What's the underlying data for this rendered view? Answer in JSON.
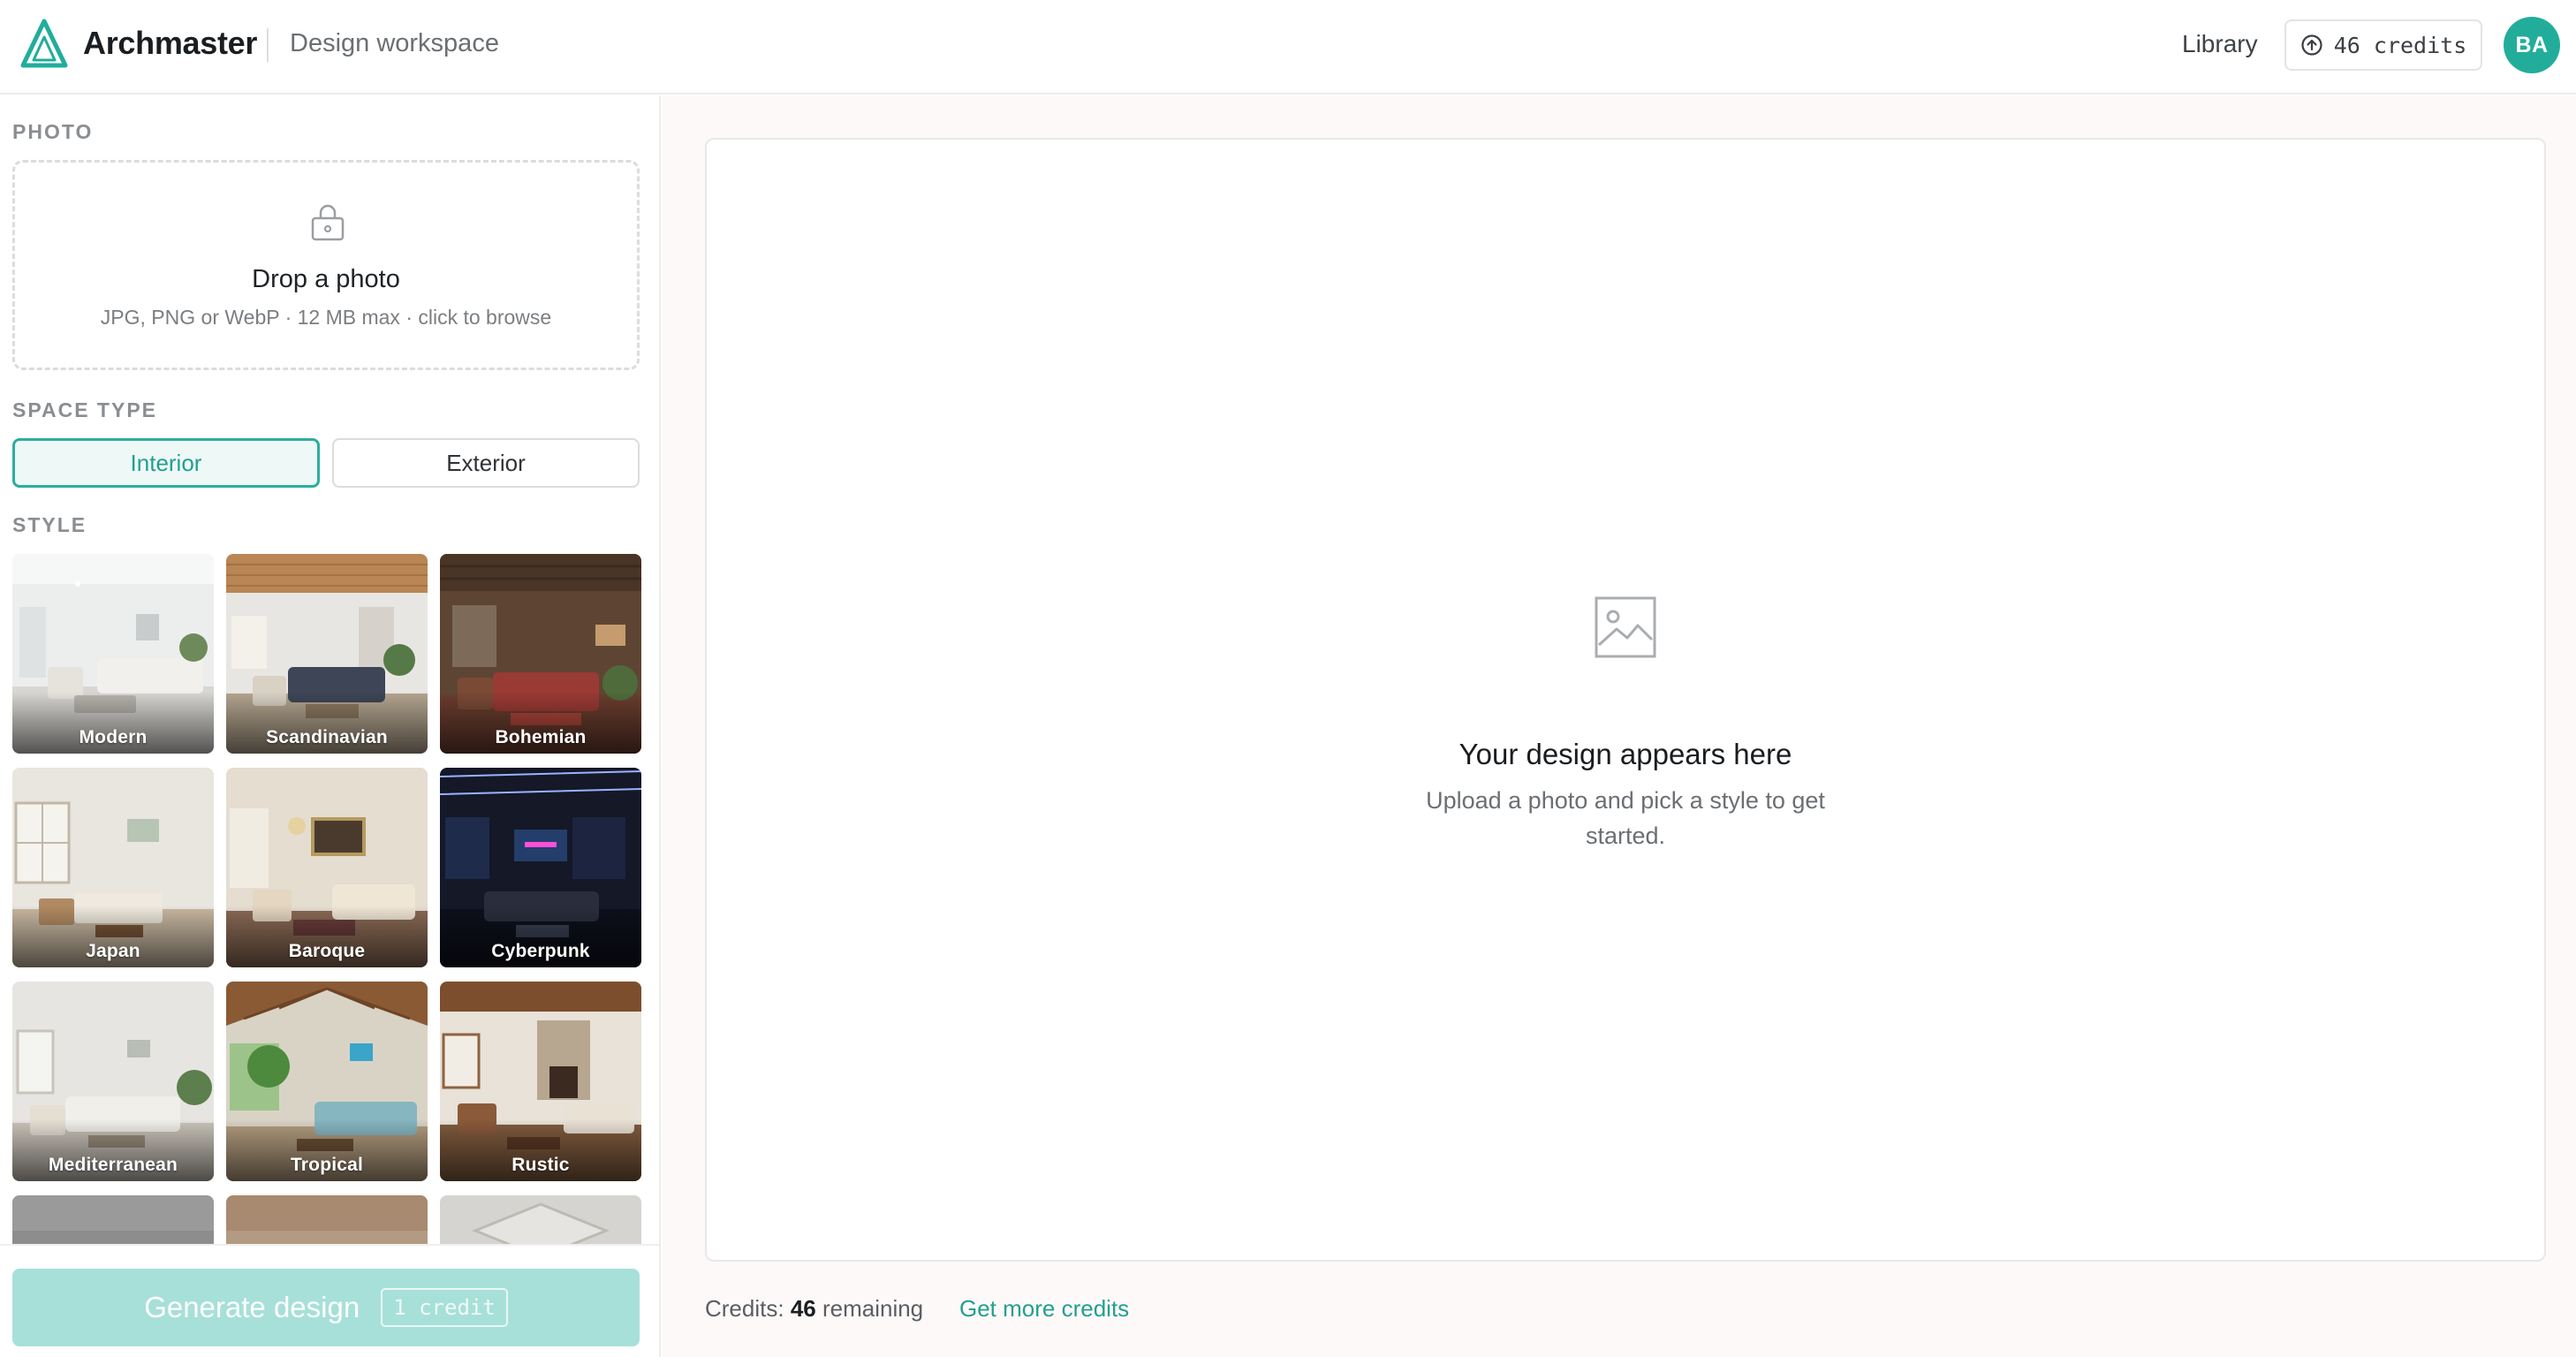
{
  "header": {
    "brand": "Archmaster",
    "workspace": "Design workspace",
    "library_label": "Library",
    "credits_pill": "46 credits",
    "avatar_initials": "BA"
  },
  "sidebar": {
    "photo_label": "PHOTO",
    "dropzone_title": "Drop a photo",
    "dropzone_hint": "JPG, PNG or WebP · 12 MB max · click to browse",
    "space_type_label": "SPACE TYPE",
    "space_types": [
      {
        "label": "Interior",
        "selected": true
      },
      {
        "label": "Exterior",
        "selected": false
      }
    ],
    "style_label": "STYLE",
    "styles": [
      {
        "label": "Modern"
      },
      {
        "label": "Scandinavian"
      },
      {
        "label": "Bohemian"
      },
      {
        "label": "Japan"
      },
      {
        "label": "Baroque"
      },
      {
        "label": "Cyberpunk"
      },
      {
        "label": "Mediterranean"
      },
      {
        "label": "Tropical"
      },
      {
        "label": "Rustic"
      },
      {
        "label": ""
      },
      {
        "label": ""
      },
      {
        "label": ""
      }
    ],
    "generate_label": "Generate design",
    "generate_cost": "1 credit"
  },
  "main": {
    "empty_title": "Your design appears here",
    "empty_subtitle": "Upload a photo and pick a style to get started.",
    "credits_prefix": "Credits:",
    "credits_value": "46",
    "credits_suffix": "remaining",
    "get_more_label": "Get more credits"
  },
  "colors": {
    "accent": "#22ad9b",
    "accent_light": "#a7e0d9",
    "canvas_bg": "#fdf9f8"
  }
}
